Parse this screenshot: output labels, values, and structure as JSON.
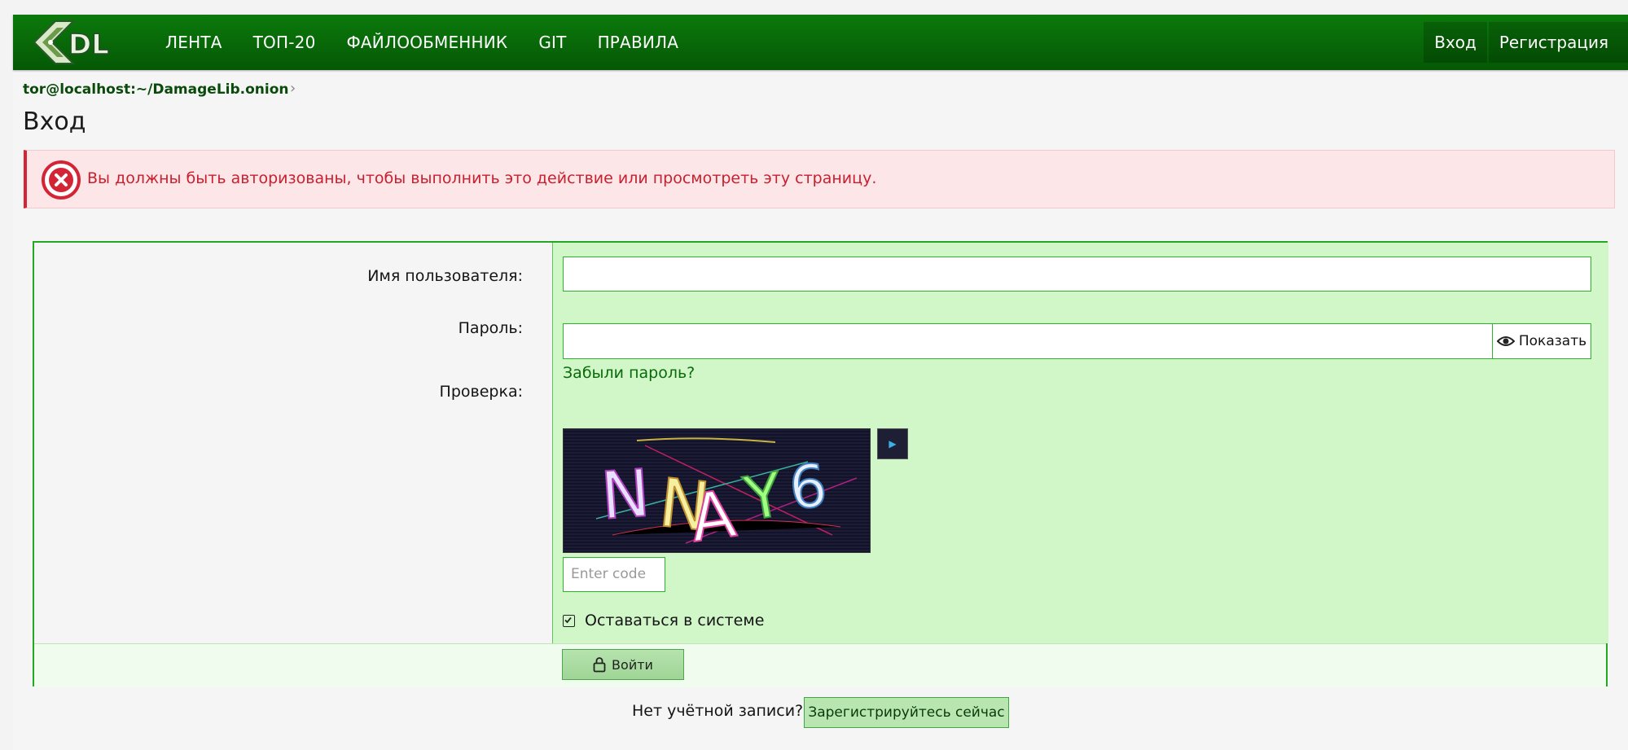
{
  "header": {
    "logo_text": "DL",
    "nav": [
      "ЛЕНТА",
      "ТОП-20",
      "ФАЙЛООБМЕННИК",
      "GIT",
      "ПРАВИЛА"
    ],
    "login_label": "Вход",
    "register_label": "Регистрация"
  },
  "breadcrumb": {
    "label": "tor@localhost:~/DamageLib.onion",
    "arrow": "›"
  },
  "page_title": "Вход",
  "error_message": "Вы должны быть авторизованы, чтобы выполнить это действие или просмотреть эту страницу.",
  "form": {
    "username_label": "Имя пользователя:",
    "username_value": "",
    "password_label": "Пароль:",
    "password_value": "",
    "show_password_label": "Показать",
    "forgot_password": "Забыли пароль?",
    "captcha_label": "Проверка:",
    "captcha_text": "NNAY6",
    "captcha_placeholder": "Enter code",
    "remember_label": "Оставаться в системе",
    "remember_checked": true,
    "submit_label": "Войти"
  },
  "footer": {
    "no_account_text": "Нет учётной записи?",
    "register_now_label": "Зарегистрируйтесь сейчас"
  },
  "colors": {
    "header_green": "#0b7a0b",
    "form_field_bg": "#d1f7c9",
    "error_red": "#d32535",
    "link_green": "#0a6a0a"
  }
}
